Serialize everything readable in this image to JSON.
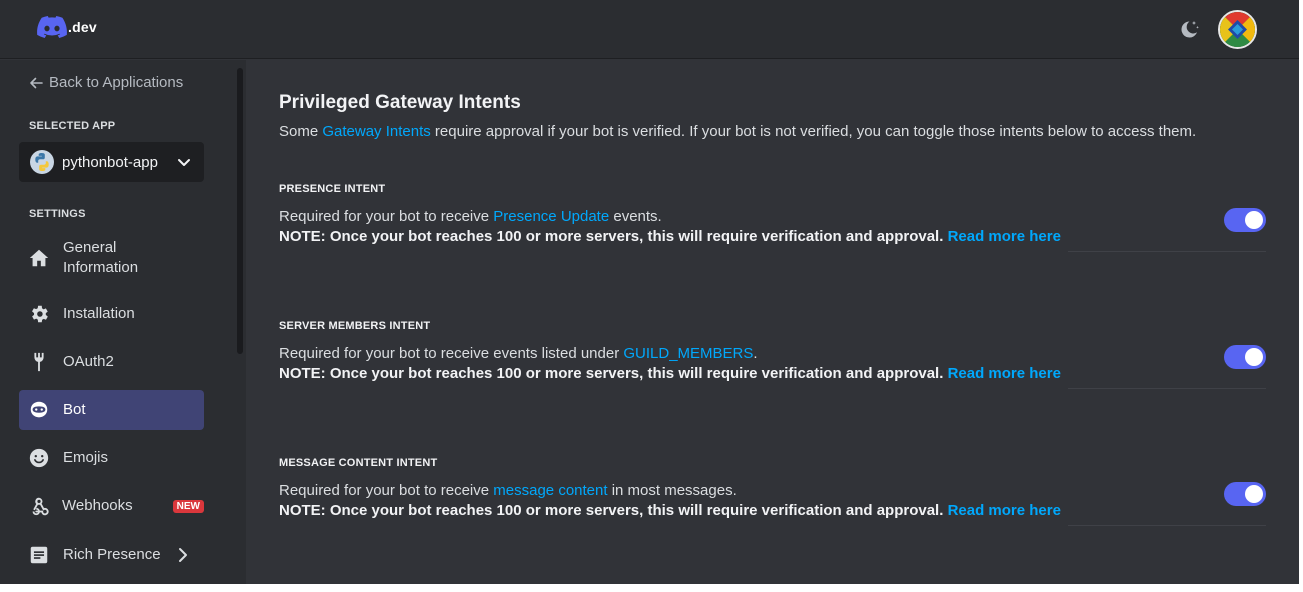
{
  "header": {
    "logo_text": ".dev",
    "theme_icon": "moon-stars-icon",
    "avatar_icon": "user-avatar"
  },
  "sidebar": {
    "back_label": "Back to Applications",
    "selected_app_label": "SELECTED APP",
    "selected_app_name": "pythonbot-app",
    "settings_label": "SETTINGS",
    "items": [
      {
        "label": "General Information",
        "icon": "home-icon",
        "active": false
      },
      {
        "label": "Installation",
        "icon": "gear-icon",
        "active": false
      },
      {
        "label": "OAuth2",
        "icon": "wrench-icon",
        "active": false
      },
      {
        "label": "Bot",
        "icon": "bot-icon",
        "active": true
      },
      {
        "label": "Emojis",
        "icon": "smile-icon",
        "active": false
      },
      {
        "label": "Webhooks",
        "icon": "webhook-icon",
        "active": false,
        "badge": "NEW"
      },
      {
        "label": "Rich Presence",
        "icon": "document-icon",
        "active": false
      }
    ]
  },
  "main": {
    "title": "Privileged Gateway Intents",
    "desc_before": "Some ",
    "desc_link": "Gateway Intents",
    "desc_after": " require approval if your bot is verified. If your bot is not verified, you can toggle those intents below to access them.",
    "intents": [
      {
        "title": "PRESENCE INTENT",
        "desc_before": "Required for your bot to receive ",
        "desc_link": "Presence Update",
        "desc_after": " events.",
        "note": "NOTE: Once your bot reaches 100 or more servers, this will require verification and approval. ",
        "note_link": "Read more here",
        "enabled": true
      },
      {
        "title": "SERVER MEMBERS INTENT",
        "desc_before": "Required for your bot to receive events listed under ",
        "desc_link": "GUILD_MEMBERS",
        "desc_after": ".",
        "note": "NOTE: Once your bot reaches 100 or more servers, this will require verification and approval. ",
        "note_link": "Read more here",
        "enabled": true
      },
      {
        "title": "MESSAGE CONTENT INTENT",
        "desc_before": "Required for your bot to receive ",
        "desc_link": "message content",
        "desc_after": " in most messages.",
        "note": "NOTE: Once your bot reaches 100 or more servers, this will require verification and approval. ",
        "note_link": "Read more here",
        "enabled": true
      }
    ]
  },
  "colors": {
    "accent": "#5865f2",
    "link": "#00a8fc",
    "background": "#313338",
    "sidebar": "#2b2d31",
    "active_item": "#404475",
    "badge": "#da373c"
  }
}
